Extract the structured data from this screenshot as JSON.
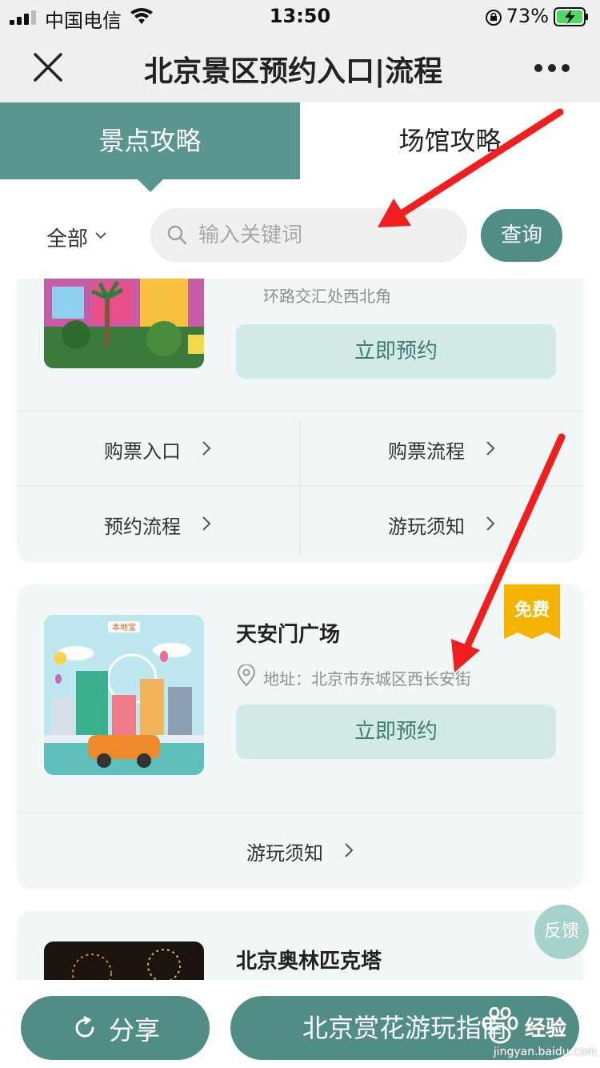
{
  "status_bar": {
    "carrier": "中国电信",
    "time": "13:50",
    "battery_percent": "73%",
    "icons": [
      "signal-icon",
      "wifi-icon",
      "rotation-lock-icon",
      "battery-charging-icon"
    ]
  },
  "nav": {
    "title": "北京景区预约入口|流程",
    "close_icon": "close-icon",
    "more_icon": "more-icon"
  },
  "tabs": [
    {
      "label": "景点攻略",
      "active": true
    },
    {
      "label": "场馆攻略",
      "active": false
    }
  ],
  "filter": {
    "category": "全部",
    "search_placeholder": "输入关键词",
    "search_value": "",
    "query_label": "查询"
  },
  "cards": [
    {
      "address_partial": "环路交汇处西北角",
      "reserve_label": "立即预约",
      "links": [
        "购票入口",
        "购票流程",
        "预约流程",
        "游玩须知"
      ]
    },
    {
      "name": "天安门广场",
      "badge": "免费",
      "address": "地址：北京市东城区西长安街",
      "thumb_logo": "本地宝",
      "reserve_label": "立即预约",
      "links": [
        "游玩须知"
      ]
    },
    {
      "name": "北京奥林匹克塔"
    }
  ],
  "feedback_label": "反馈",
  "bottom": {
    "share_label": "分享",
    "guide_label": "北京赏花游玩指南"
  },
  "watermark": {
    "text": "经验",
    "url": "jingyan.baidu.com"
  },
  "colors": {
    "accent": "#5a9590",
    "button": "#4f8d85",
    "card_bg": "#f0f7f6",
    "reserve_bg": "#d2eae6",
    "badge": "#f5b400",
    "annotation_arrow": "#f21d1d"
  }
}
